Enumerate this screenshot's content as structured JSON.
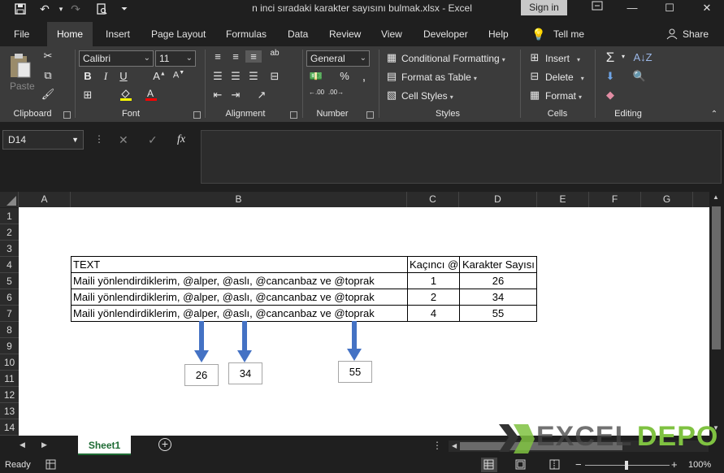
{
  "window": {
    "title": "n inci sıradaki karakter sayısını bulmak.xlsx  -  Excel",
    "signin": "Sign in"
  },
  "tabs": [
    {
      "label": "File"
    },
    {
      "label": "Home"
    },
    {
      "label": "Insert"
    },
    {
      "label": "Page Layout"
    },
    {
      "label": "Formulas"
    },
    {
      "label": "Data"
    },
    {
      "label": "Review"
    },
    {
      "label": "View"
    },
    {
      "label": "Developer"
    },
    {
      "label": "Help"
    },
    {
      "label": "Tell me"
    },
    {
      "label": "Share"
    }
  ],
  "ribbon": {
    "clipboard": {
      "label": "Clipboard",
      "paste": "Paste"
    },
    "font": {
      "label": "Font",
      "name": "Calibri",
      "size": "11"
    },
    "alignment": {
      "label": "Alignment"
    },
    "number": {
      "label": "Number",
      "format": "General"
    },
    "styles": {
      "label": "Styles",
      "conditional": "Conditional Formatting",
      "format_table": "Format as Table",
      "cell_styles": "Cell Styles"
    },
    "cells": {
      "label": "Cells",
      "insert": "Insert",
      "delete": "Delete",
      "format": "Format"
    },
    "editing": {
      "label": "Editing"
    }
  },
  "formula_bar": {
    "name_box": "D14",
    "fx": "fx",
    "value": ""
  },
  "columns": [
    "A",
    "B",
    "C",
    "D",
    "E",
    "F",
    "G"
  ],
  "rows": [
    "1",
    "2",
    "3",
    "4",
    "5",
    "6",
    "7",
    "8",
    "9",
    "10",
    "11",
    "12",
    "13",
    "14"
  ],
  "table": {
    "headers": [
      "TEXT",
      "Kaçıncı @",
      "Karakter Sayısı"
    ],
    "rows": [
      [
        "Maili yönlendirdiklerim, @alper, @aslı, @cancanbaz ve @toprak",
        "1",
        "26"
      ],
      [
        "Maili yönlendirdiklerim, @alper, @aslı, @cancanbaz ve @toprak",
        "2",
        "34"
      ],
      [
        "Maili yönlendirdiklerim, @alper, @aslı, @cancanbaz ve @toprak",
        "4",
        "55"
      ]
    ]
  },
  "callouts": [
    "26",
    "34",
    "55"
  ],
  "sheet_tabs": [
    "Sheet1"
  ],
  "status": {
    "ready": "Ready",
    "zoom": "100%"
  },
  "watermark": {
    "part1": "EXCEL",
    "part2": "DEPO"
  },
  "colors": {
    "accent_green": "#1e6b34",
    "arrow_blue": "#4472c4",
    "watermark_green": "#7fc241"
  }
}
